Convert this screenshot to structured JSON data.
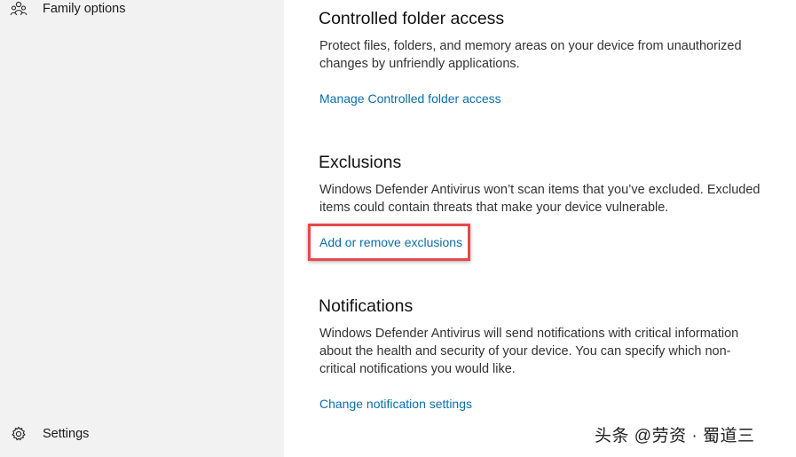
{
  "sidebar": {
    "items": [
      {
        "label": "Family options",
        "icon": "family-icon"
      },
      {
        "label": "Settings",
        "icon": "gear-icon"
      }
    ]
  },
  "sections": {
    "controlled_folder_access": {
      "title": "Controlled folder access",
      "description": "Protect files, folders, and memory areas on your device from unauthorized changes by unfriendly applications.",
      "link": "Manage Controlled folder access"
    },
    "exclusions": {
      "title": "Exclusions",
      "description": "Windows Defender Antivirus won’t scan items that you’ve excluded. Excluded items could contain threats that make your device vulnerable.",
      "link": "Add or remove exclusions"
    },
    "notifications": {
      "title": "Notifications",
      "description": "Windows Defender Antivirus will send notifications with critical information about the health and security of your device. You can specify which non-critical notifications you would like.",
      "link": "Change notification settings"
    }
  },
  "watermark": "头条 @劳资 · 蜀道三",
  "colors": {
    "link": "#0a6ea8",
    "highlight": "#e5484d",
    "sidebar_bg": "#f2f2f2"
  }
}
